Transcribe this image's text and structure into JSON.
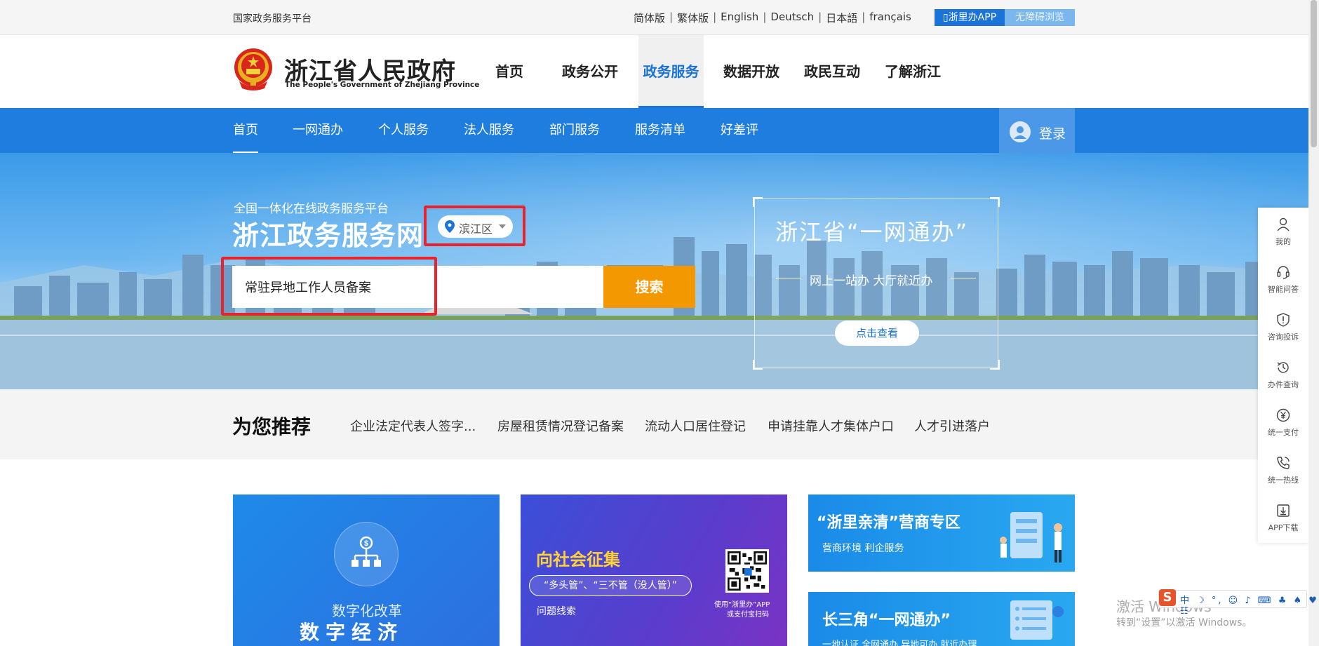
{
  "topbar": {
    "national_platform": "国家政务服务平台",
    "languages": [
      "简体版",
      "繁体版",
      "English",
      "Deutsch",
      "日本語",
      "français"
    ],
    "app_button": "浙里办APP",
    "a11y_button": "无障碍浏览"
  },
  "header": {
    "site_name": "浙江省人民政府",
    "site_name_en": "The People's Government of Zhejiang Province",
    "main_nav": [
      "首页",
      "政务公开",
      "政务服务",
      "数据开放",
      "政民互动",
      "了解浙江"
    ],
    "active_main_nav": "政务服务"
  },
  "subnav": {
    "items": [
      "首页",
      "一网通办",
      "个人服务",
      "法人服务",
      "部门服务",
      "服务清单",
      "好差评"
    ],
    "active": "首页",
    "login": "登录"
  },
  "banner": {
    "small_title": "全国一体化在线政务服务平台",
    "title": "浙江政务服务网",
    "region": "滨江区",
    "search_value": "常驻异地工作人员备案",
    "search_button": "搜索",
    "promo_title": "浙江省“一网通办”",
    "promo_sub": "网上一站办 大厅就近办",
    "promo_button": "点击查看"
  },
  "recommend": {
    "title": "为您推荐",
    "items": [
      "企业法定代表人签字...",
      "房屋租赁情况登记备案",
      "流动人口居住登记",
      "申请挂靠人才集体户口",
      "人才引进落户"
    ]
  },
  "cards": {
    "card1_sub": "数字化改革",
    "card1_big": "数字经济",
    "card2_title": "向社会征集",
    "card2_pill": "“多头管”、“三不管（没人管）”",
    "card2_sub": "问题线索",
    "card2_qr_caption1": "使用“浙里办”APP",
    "card2_qr_caption2": "或支付宝扫码",
    "card3_title": "“浙里亲清”营商专区",
    "card3_sub": "营商环境 利企服务",
    "card4_title": "长三角“一网通办”",
    "card4_sub": "一地认证 全网通办 异地可办 就近办理"
  },
  "floatbar": {
    "items": [
      {
        "label": "我的",
        "icon": "user-icon"
      },
      {
        "label": "智能问答",
        "icon": "headset-icon"
      },
      {
        "label": "咨询投诉",
        "icon": "shield-icon"
      },
      {
        "label": "办件查询",
        "icon": "history-icon"
      },
      {
        "label": "统一支付",
        "icon": "yen-icon"
      },
      {
        "label": "统一热线",
        "icon": "phone-icon"
      },
      {
        "label": "APP下载",
        "icon": "download-icon"
      }
    ]
  },
  "watermark": {
    "line1": "激活 Windows",
    "line2": "转到“设置”以激活 Windows。"
  },
  "ime": {
    "logo": "S",
    "text": "中 ☽ °, ☺ ♪ ⌨ ♣ ♠ ♥ ☷"
  },
  "colors": {
    "primary_blue": "#1f7de0",
    "search_orange": "#f39800",
    "highlight_red": "#e8232b"
  }
}
